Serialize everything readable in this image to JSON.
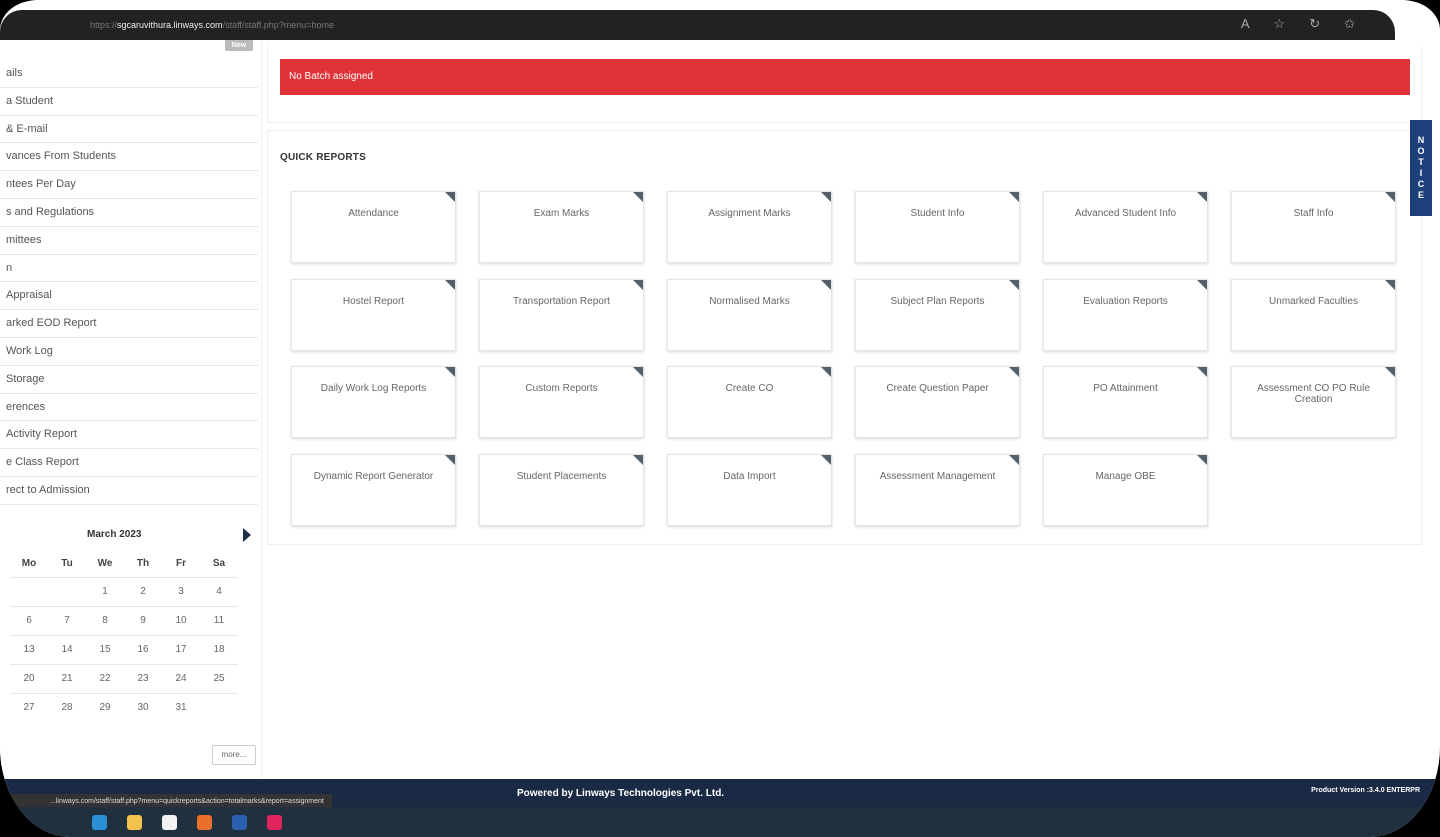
{
  "browser": {
    "url_proto": "https://",
    "url_domain": "sgcaruvithura.linways.com",
    "url_path": "/staff/staff.php?menu=home"
  },
  "sidebar": {
    "new_badge": "New",
    "items": [
      "ails",
      "a Student",
      "& E-mail",
      "vances From Students",
      "ntees Per Day",
      "s and Regulations",
      "mittees",
      "n",
      " Appraisal",
      "arked EOD Report",
      " Work Log",
      "Storage",
      "erences",
      " Activity Report",
      "e Class Report",
      "rect to Admission"
    ]
  },
  "calendar": {
    "title": "March 2023",
    "weekdays": [
      "Mo",
      "Tu",
      "We",
      "Th",
      "Fr",
      "Sa"
    ],
    "weeks": [
      [
        "",
        "",
        "1",
        "2",
        "3",
        "4"
      ],
      [
        "6",
        "7",
        "8",
        "9",
        "10",
        "11"
      ],
      [
        "13",
        "14",
        "15",
        "16",
        "17",
        "18"
      ],
      [
        "20",
        "21",
        "22",
        "23",
        "24",
        "25"
      ],
      [
        "27",
        "28",
        "29",
        "30",
        "31",
        ""
      ]
    ],
    "more_label": "more..."
  },
  "alert": {
    "text": "No Batch assigned",
    "color": "#e03337"
  },
  "quick_reports": {
    "title": "QUICK REPORTS",
    "cards": [
      "Attendance",
      "Exam Marks",
      "Assignment Marks",
      "Student Info",
      "Advanced Student Info",
      "Staff Info",
      "Hostel Report",
      "Transportation Report",
      "Normalised Marks",
      "Subject Plan Reports",
      "Evaluation Reports",
      "Unmarked Faculties",
      "Daily Work Log Reports",
      "Custom Reports",
      "Create CO",
      "Create Question Paper",
      "PO Attainment",
      "Assessment CO PO Rule Creation",
      "Dynamic Report Generator",
      "Student Placements",
      "Data Import",
      "Assessment Management",
      "Manage OBE"
    ]
  },
  "notice": {
    "letters": [
      "N",
      "O",
      "T",
      "I",
      "C",
      "E"
    ],
    "color": "#1d3f7a"
  },
  "footer": {
    "powered": "Powered by Linways Technologies Pvt. Ltd.",
    "version": "Product Version :3.4.0 ENTERPR",
    "status_url": "...linways.com/staff/staff.php?menu=quickreports&action=totalmarks&report=assignment"
  },
  "taskbar": {
    "icons": [
      {
        "name": "edge-icon",
        "color": "#2b8fd6"
      },
      {
        "name": "file-explorer-icon",
        "color": "#f2c14e"
      },
      {
        "name": "store-icon",
        "color": "#f2f2f2"
      },
      {
        "name": "firefox-icon",
        "color": "#e8702a"
      },
      {
        "name": "word-icon",
        "color": "#2b5fb0"
      },
      {
        "name": "app-m-icon",
        "color": "#e0245e"
      }
    ]
  }
}
